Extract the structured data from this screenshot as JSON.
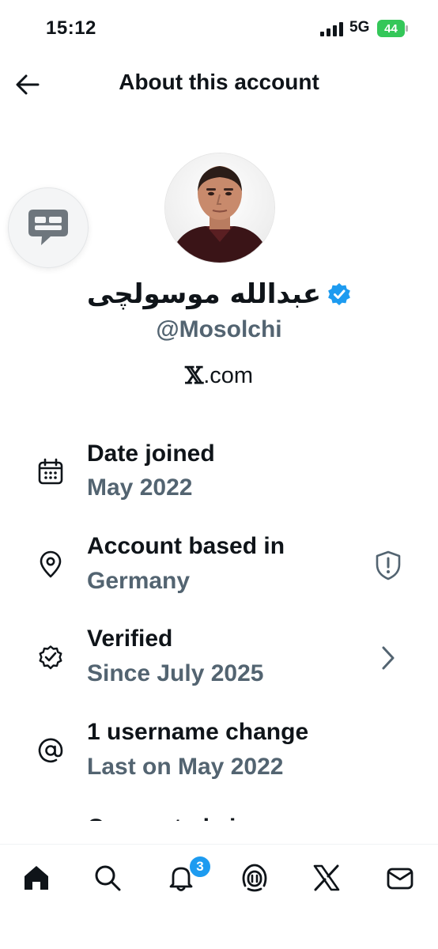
{
  "status_bar": {
    "time": "15:12",
    "network": "5G",
    "battery": "44"
  },
  "header": {
    "title": "About this account",
    "back_icon": "arrow-left-icon"
  },
  "profile": {
    "display_name": "عبدالله موسولچی",
    "verified_icon": "verified-badge-icon",
    "handle": "@Mosolchi",
    "site_glyph": "𝕏",
    "site_text": ".com"
  },
  "info_rows": [
    {
      "icon": "calendar-icon",
      "title": "Date joined",
      "subtitle": "May 2022"
    },
    {
      "icon": "location-pin-icon",
      "title": "Account based in",
      "subtitle": "Germany",
      "trailing_icon": "shield-alert-icon"
    },
    {
      "icon": "verified-seal-icon",
      "title": "Verified",
      "subtitle": "Since July 2025",
      "trailing_icon": "chevron-right-icon"
    },
    {
      "icon": "at-sign-icon",
      "title": "1 username change",
      "subtitle": "Last on May 2022"
    }
  ],
  "partial_row_text": "Connected via",
  "tab_bar": {
    "tabs": [
      "home-icon",
      "search-icon",
      "notifications-icon",
      "grok-icon",
      "x-logo-icon",
      "messages-icon"
    ],
    "notifications_badge": "3"
  },
  "colors": {
    "text_primary": "#0f1419",
    "text_secondary": "#536471",
    "accent_blue": "#1d9bf0",
    "battery_green": "#34c759"
  }
}
